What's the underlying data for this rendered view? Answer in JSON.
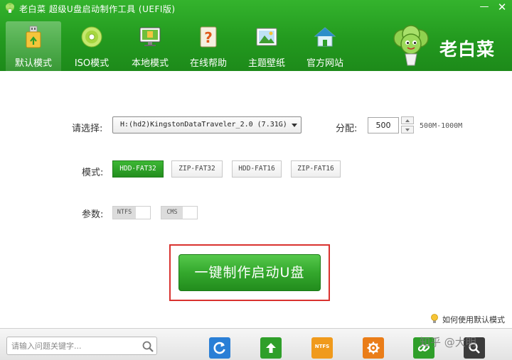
{
  "window": {
    "title": "老白菜 超级U盘启动制作工具 (UEFI版)",
    "minimize_glyph": "—",
    "close_glyph": "✕"
  },
  "nav": {
    "items": [
      {
        "label": "默认模式",
        "icon": "usb-drive-icon",
        "active": true
      },
      {
        "label": "ISO模式",
        "icon": "disc-icon",
        "active": false
      },
      {
        "label": "本地模式",
        "icon": "monitor-icon",
        "active": false
      },
      {
        "label": "在线帮助",
        "icon": "help-icon",
        "active": false
      },
      {
        "label": "主题壁纸",
        "icon": "wallpaper-icon",
        "active": false
      },
      {
        "label": "官方网站",
        "icon": "home-icon",
        "active": false
      }
    ]
  },
  "brand": {
    "name": "老白菜",
    "mascot_icon": "cabbage-mascot-icon"
  },
  "main": {
    "select_label": "请选择:",
    "drive_value": "H:(hd2)KingstonDataTraveler_2.0 (7.31G)",
    "alloc_label": "分配:",
    "alloc_value": "500",
    "alloc_range": "500M-1000M",
    "mode_label": "模式:",
    "modes": [
      {
        "label": "HDD-FAT32",
        "active": true
      },
      {
        "label": "ZIP-FAT32",
        "active": false
      },
      {
        "label": "HDD-FAT16",
        "active": false
      },
      {
        "label": "ZIP-FAT16",
        "active": false
      }
    ],
    "param_label": "参数:",
    "params": [
      {
        "label": "NTFS",
        "on": false
      },
      {
        "label": "CMS",
        "on": false
      }
    ],
    "make_button": "一键制作启动U盘",
    "help_link": "如何使用默认模式"
  },
  "footer": {
    "search_placeholder": "请输入问题关键字...",
    "tools": [
      {
        "name": "refresh-icon",
        "color": "#2a7fd6"
      },
      {
        "name": "upgrade-icon",
        "color": "#2f9f2a"
      },
      {
        "name": "ntfs-convert-icon",
        "label": "NTFS",
        "color": "#f09a1c"
      },
      {
        "name": "settings-icon",
        "color": "#ea7d18"
      },
      {
        "name": "link-icon",
        "color": "#2f9f2a"
      },
      {
        "name": "search-icon",
        "color": "#3b3b3b"
      }
    ],
    "watermark": "知乎 @大明"
  },
  "colors": {
    "brand_green": "#239a1f",
    "highlight_red": "#d9322f"
  }
}
